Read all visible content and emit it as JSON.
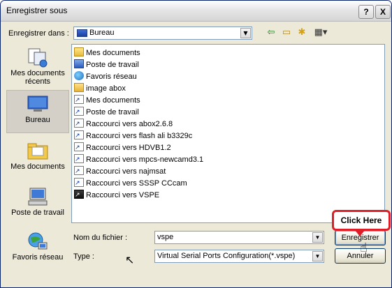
{
  "window": {
    "title": "Enregistrer sous",
    "help_glyph": "?",
    "close_glyph": "X"
  },
  "toolbar": {
    "save_in_label": "Enregistrer dans :",
    "save_in_value": "Bureau",
    "icons": [
      "back-arrow-icon",
      "up-folder-icon",
      "new-folder-icon",
      "view-menu-icon"
    ]
  },
  "places": [
    {
      "label": "Mes documents récents",
      "icon": "recent-documents-icon"
    },
    {
      "label": "Bureau",
      "icon": "desktop-icon",
      "selected": true
    },
    {
      "label": "Mes documents",
      "icon": "my-documents-icon"
    },
    {
      "label": "Poste de travail",
      "icon": "my-computer-icon"
    },
    {
      "label": "Favoris réseau",
      "icon": "network-places-icon"
    }
  ],
  "files": [
    {
      "name": "Mes documents",
      "icon": "docs"
    },
    {
      "name": "Poste de travail",
      "icon": "pc"
    },
    {
      "name": "Favoris réseau",
      "icon": "net"
    },
    {
      "name": "image abox",
      "icon": "folder"
    },
    {
      "name": "Mes documents",
      "icon": "shortcut"
    },
    {
      "name": "Poste de travail",
      "icon": "shortcut"
    },
    {
      "name": "Raccourci vers abox2.6.8",
      "icon": "shortcut"
    },
    {
      "name": "Raccourci vers flash ali b3329c",
      "icon": "shortcut"
    },
    {
      "name": "Raccourci vers HDVB1.2",
      "icon": "shortcut"
    },
    {
      "name": "Raccourci vers mpcs-newcamd3.1",
      "icon": "shortcut"
    },
    {
      "name": "Raccourci vers najmsat",
      "icon": "shortcut"
    },
    {
      "name": "Raccourci vers SSSP CCcam",
      "icon": "shortcut"
    },
    {
      "name": "Raccourci vers VSPE",
      "icon": "vspe"
    }
  ],
  "form": {
    "filename_label": "Nom du fichier :",
    "filename_value": "vspe",
    "type_label": "Type :",
    "type_value": "Virtual Serial Ports Configuration(*.vspe)"
  },
  "buttons": {
    "save": "Enregistrer",
    "cancel": "Annuler"
  },
  "callout": {
    "text": "Click Here"
  }
}
